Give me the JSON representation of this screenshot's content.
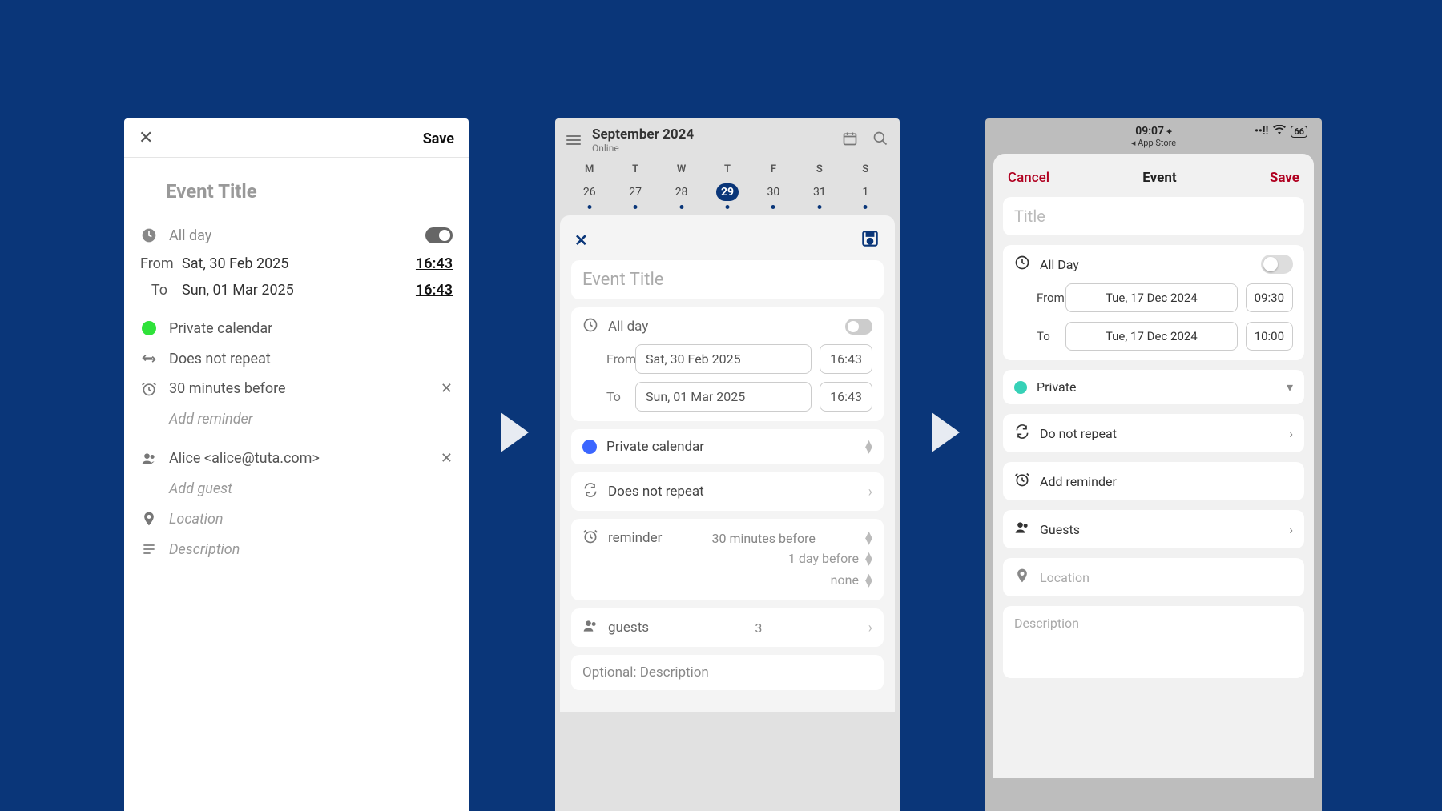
{
  "panel1": {
    "save_label": "Save",
    "title_placeholder": "Event Title",
    "allday_label": "All day",
    "from_label": "From",
    "to_label": "To",
    "from_date": "Sat, 30 Feb 2025",
    "from_time": "16:43",
    "to_date": "Sun, 01 Mar 2025",
    "to_time": "16:43",
    "calendar_label": "Private calendar",
    "calendar_color": "#2fe23a",
    "repeat_label": "Does not repeat",
    "reminder_text": "30 minutes before",
    "add_reminder": "Add reminder",
    "guest_text": "Alice <alice@tuta.com>",
    "add_guest": "Add guest",
    "location_placeholder": "Location",
    "description_placeholder": "Description"
  },
  "panel2": {
    "month_title": "September 2024",
    "online_label": "Online",
    "day_headers": [
      "M",
      "T",
      "W",
      "T",
      "F",
      "S",
      "S"
    ],
    "dates": [
      "26",
      "27",
      "28",
      "29",
      "30",
      "31",
      "1"
    ],
    "selected_index": 3,
    "title_placeholder": "Event Title",
    "allday_label": "All day",
    "from_label": "From",
    "to_label": "To",
    "from_date": "Sat, 30 Feb 2025",
    "from_time": "16:43",
    "to_date": "Sun, 01 Mar 2025",
    "to_time": "16:43",
    "calendar_label": "Private calendar",
    "calendar_color": "#3b66ff",
    "repeat_label": "Does not repeat",
    "reminder_label": "reminder",
    "reminders": [
      "30 minutes before",
      "1 day before",
      "none"
    ],
    "guests_label": "guests",
    "guests_count": "3",
    "description_placeholder": "Optional: Description"
  },
  "panel3": {
    "status_time": "09:07",
    "status_back": "App Store",
    "battery": "66",
    "cancel_label": "Cancel",
    "header_label": "Event",
    "save_label": "Save",
    "title_placeholder": "Title",
    "allday_label": "All Day",
    "from_label": "From",
    "to_label": "To",
    "from_date": "Tue, 17 Dec 2024",
    "from_time": "09:30",
    "to_date": "Tue, 17 Dec 2024",
    "to_time": "10:00",
    "calendar_label": "Private",
    "calendar_color": "#36d1b7",
    "repeat_label": "Do not repeat",
    "add_reminder": "Add reminder",
    "guests_label": "Guests",
    "location_placeholder": "Location",
    "description_placeholder": "Description"
  }
}
